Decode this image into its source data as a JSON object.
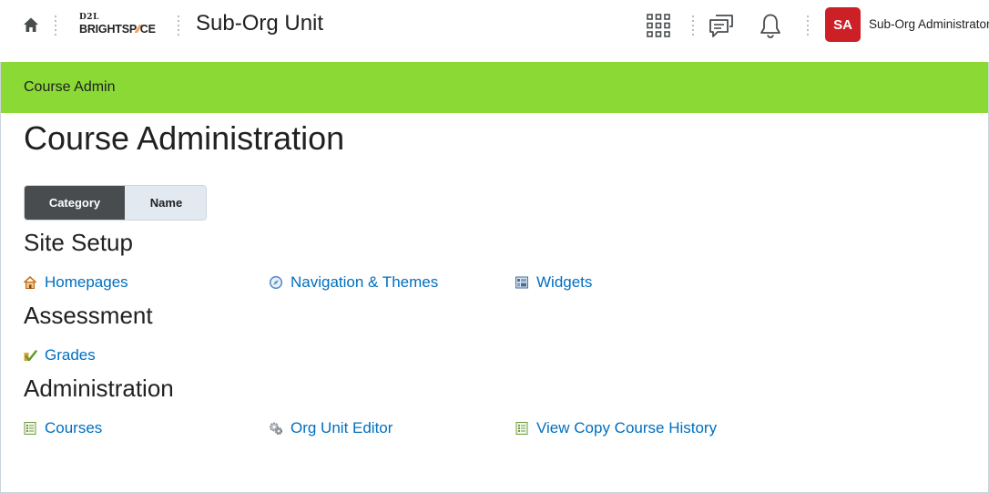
{
  "header": {
    "logo_small": "D2L",
    "logo_main_a": "BRIGHTSP",
    "logo_main_accent": "⁄⁄",
    "logo_main_b": "CE",
    "org_unit_title": "Sub-Org Unit",
    "user": {
      "initials": "SA",
      "name": "Sub-Org Administrator",
      "avatar_color": "#cd2026"
    },
    "icons": [
      "home-icon",
      "waffle-icon",
      "messages-icon",
      "notifications-icon"
    ]
  },
  "navbar": {
    "link": "Course Admin",
    "color": "#8ad934"
  },
  "main": {
    "title": "Course Administration",
    "view_toggle": {
      "active": "Category",
      "inactive": "Name"
    },
    "sections": [
      {
        "heading": "Site Setup",
        "tools": [
          {
            "label": "Homepages",
            "icon": "house-icon"
          },
          {
            "label": "Navigation & Themes",
            "icon": "compass-icon"
          },
          {
            "label": "Widgets",
            "icon": "widget-grid-icon"
          }
        ]
      },
      {
        "heading": "Assessment",
        "tools": [
          {
            "label": "Grades",
            "icon": "checkmark-grade-icon"
          }
        ]
      },
      {
        "heading": "Administration",
        "tools": [
          {
            "label": "Courses",
            "icon": "list-icon"
          },
          {
            "label": "Org Unit Editor",
            "icon": "gears-icon"
          },
          {
            "label": "View Copy Course History",
            "icon": "list-icon"
          }
        ]
      }
    ],
    "link_color": "#006fbf"
  }
}
